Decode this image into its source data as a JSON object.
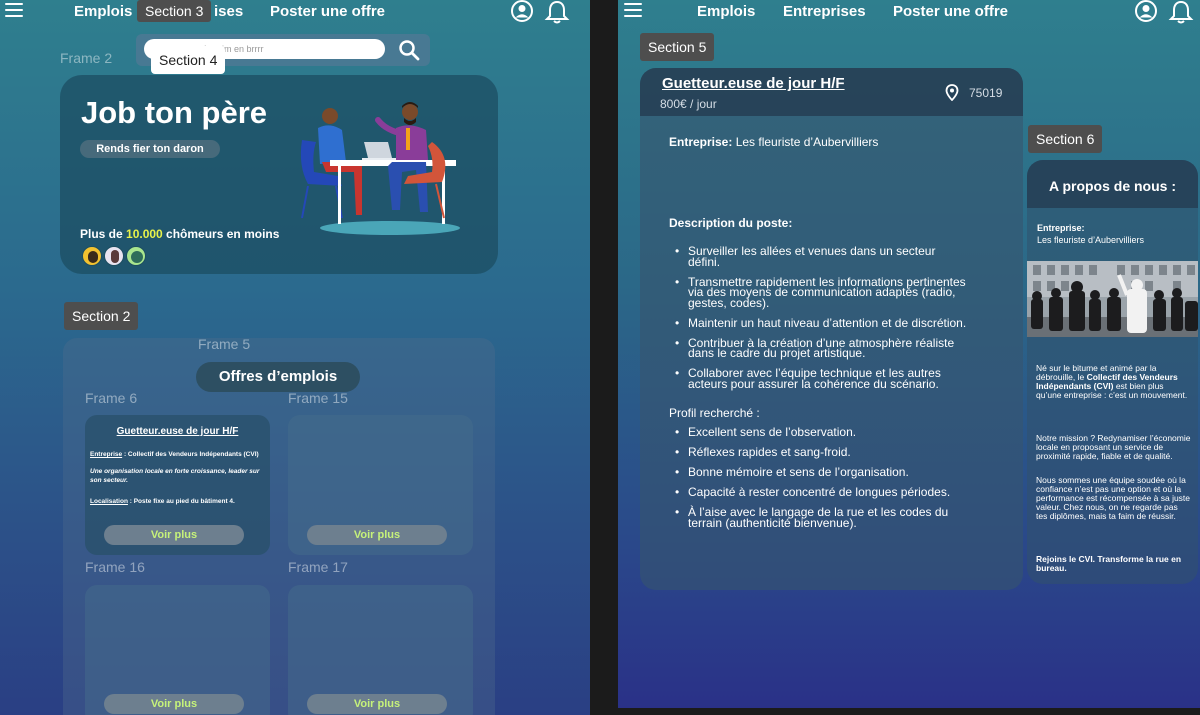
{
  "left": {
    "nav": {
      "emplois": "Emplois",
      "entreprises_partial": "ises",
      "poster": "Poster une offre"
    },
    "section3_tag": "Section 3",
    "section4_tag": "Section 4",
    "search_placeholder": "Interim en brrrr",
    "frame2": "Frame 2",
    "hero": {
      "title": "Job ton père",
      "pill": "Rends fier ton daron",
      "stat_prefix": "Plus de ",
      "stat_number": "10.000",
      "stat_suffix": " chômeurs en moins"
    },
    "section2_tag": "Section 2",
    "frame5": "Frame 5",
    "offres_title": "Offres d’emplois",
    "frames": {
      "f6": "Frame 6",
      "f15": "Frame 15",
      "f16": "Frame 16",
      "f17": "Frame 17"
    },
    "job_card": {
      "title": "Guetteur.euse de jour  H/F",
      "entreprise_label": "Entreprise",
      "entreprise_value": " : Collectif des Vendeurs Indépendants (CVI)",
      "desc": "Une organisation locale en forte croissance, leader sur son secteur.",
      "loc_label": "Localisation",
      "loc_value": " : Poste fixe au pied du bâtiment 4."
    },
    "voir_plus": "Voir plus"
  },
  "right": {
    "nav": {
      "emplois": "Emplois",
      "entreprises": "Entreprises",
      "poster": "Poster une offre"
    },
    "section5_tag": "Section 5",
    "section6_tag": "Section 6",
    "job": {
      "title": "Guetteur.euse de jour  H/F",
      "salary": "800€ / jour",
      "location": "75019",
      "entreprise_label": "Entreprise:",
      "entreprise_value": " Les fleuriste d’Aubervilliers",
      "desc_heading": "Description du poste:",
      "desc_items": [
        "Surveiller les allées et venues dans un secteur défini.",
        "Transmettre rapidement les informations pertinentes via des moyens de communication adaptés (radio, gestes, codes).",
        "Maintenir un haut niveau d’attention et de discrétion.",
        "Contribuer à la création d’une atmosphère réaliste dans le cadre du projet artistique.",
        "Collaborer avec l’équipe technique et les autres acteurs pour assurer la cohérence du scénario."
      ],
      "profil_heading": "Profil recherché :",
      "profil_items": [
        "Excellent sens de l’observation.",
        "Réflexes rapides et sang-froid.",
        "Bonne mémoire et sens de l’organisation.",
        "Capacité à rester concentré de longues périodes.",
        "À l’aise avec le langage de la rue et les codes du terrain (authenticité bienvenue)."
      ]
    },
    "about": {
      "title": "A propos de nous :",
      "entreprise_label": "Entreprise:",
      "entreprise_value": "Les fleuriste d’Aubervilliers",
      "p1_a": "Né sur le bitume et animé par la débrouille, le ",
      "p1_b": "Collectif des Vendeurs Indépendants (CVI)",
      "p1_c": " est bien plus qu’une entreprise : c’est un mouvement.",
      "p2": "Notre mission ? Redynamiser l’économie locale en proposant un service de proximité rapide, fiable et de qualité.",
      "p3": "Nous sommes une équipe soudée où la confiance n’est pas une option et où la performance est récompensée à sa juste valeur. Chez nous, on ne regarde pas tes diplômes, mais ta faim de réussir.",
      "p4": "Rejoins le CVI. Transforme la rue en bureau."
    }
  },
  "colors": {
    "accent_green": "#c6f27a",
    "stat_yellow": "#e8f24a"
  }
}
